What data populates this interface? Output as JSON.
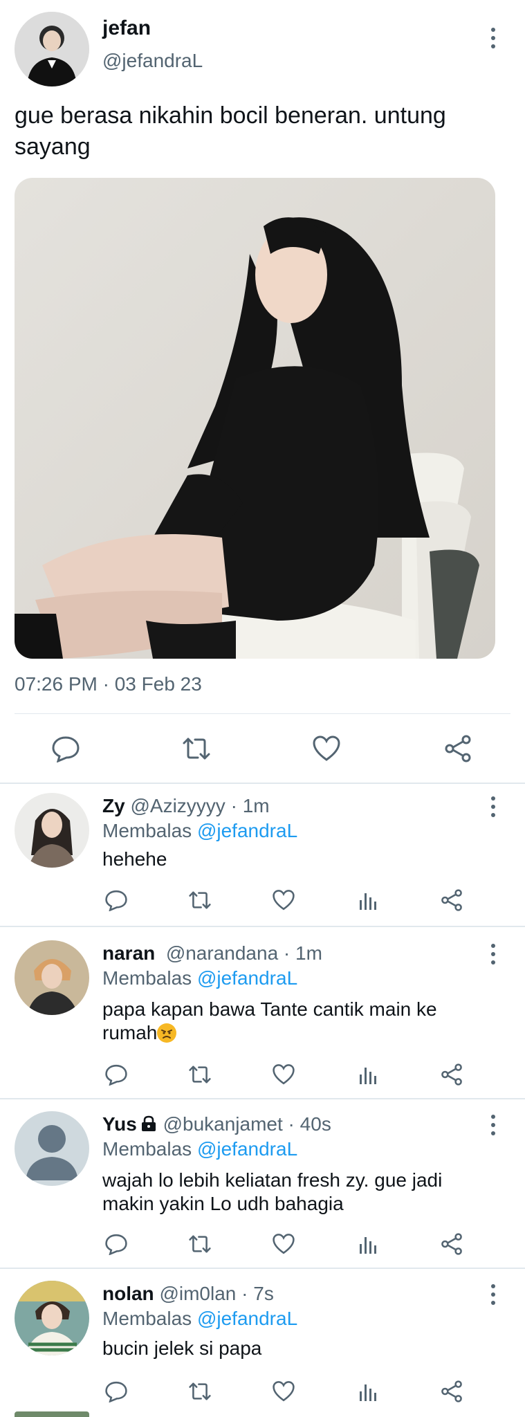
{
  "tweet": {
    "author_name": "jefan",
    "author_handle": "@jefandraL",
    "text": "gue berasa nikahin bocil beneran. untung sayang",
    "timestamp": "07:26 PM · 03 Feb 23",
    "actions": [
      "reply-icon",
      "retweet-icon",
      "like-icon",
      "share-icon"
    ]
  },
  "replies": [
    {
      "name": "Zy",
      "handle": "@Azizyyyy",
      "time": "1m",
      "replying_prefix": "Membalas",
      "replying_to": "@jefandraL",
      "text": "hehehe"
    },
    {
      "name": "naran",
      "handle": "@narandana",
      "time": "1m",
      "replying_prefix": "Membalas",
      "replying_to": "@jefandraL",
      "text": "papa kapan bawa Tante cantik main ke rumah"
    },
    {
      "name": "Yus",
      "handle": "@bukanjamet",
      "time": "40s",
      "replying_prefix": "Membalas",
      "replying_to": "@jefandraL",
      "text": "wajah lo lebih keliatan fresh zy. gue jadi makin yakin Lo udh bahagia"
    },
    {
      "name": "nolan",
      "handle": "@im0lan",
      "time": "7s",
      "replying_prefix": "Membalas",
      "replying_to": "@jefandraL",
      "text": "bucin jelek si papa"
    }
  ],
  "colors": {
    "text": "#0f1419",
    "secondary": "#536471",
    "mention": "#1d9bf0",
    "divider": "#e1e8ed"
  }
}
